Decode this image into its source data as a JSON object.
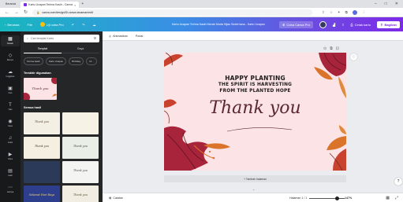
{
  "browser": {
    "tabs": [
      {
        "label": "Beranda"
      },
      {
        "label": "Kartu Ucapan Terima Kasih - Canva"
      }
    ],
    "url": "canva.com/design/Dl-canva-tanaman/edit",
    "controls": [
      "–",
      "□",
      "✕"
    ]
  },
  "header": {
    "home_label": "Beranda",
    "file_label": "File",
    "trial_label": "Uji coba Pro",
    "doc_title": "Kartu Ucapan Terima Kasih Merah Muda Hijau Sederhana - Kartu Ucapan",
    "pro_button": "Coba Canva Pro",
    "print_label": "Cetak kartu",
    "share_label": "Bagikan"
  },
  "rail": {
    "items": [
      {
        "label": "Desain",
        "icon": "▦"
      },
      {
        "label": "Elemen",
        "icon": "◇"
      },
      {
        "label": "Unggahan",
        "icon": "☁"
      },
      {
        "label": "Foto",
        "icon": "▣"
      },
      {
        "label": "Teks",
        "icon": "T"
      },
      {
        "label": "Gaya",
        "icon": "◉"
      },
      {
        "label": "Audio",
        "icon": "♫"
      },
      {
        "label": "Video",
        "icon": "▶"
      },
      {
        "label": "Latar",
        "icon": "▤"
      },
      {
        "label": "Lainnya",
        "icon": "⋯"
      }
    ]
  },
  "panel": {
    "search_placeholder": "Cari templat Kartu",
    "tabs": [
      {
        "label": "Templat"
      },
      {
        "label": "Gaya"
      }
    ],
    "chips": [
      "Terima kasih",
      "Kartu Ucapan",
      "Birthday",
      "Ul..."
    ],
    "recent_heading": "Terakhir digunakan",
    "all_heading": "Semua hasil",
    "recent_thumb_text": "Thank you",
    "templates": [
      {
        "text": "Thank you",
        "color": "#f3efe4",
        "text_color": "#5a4634"
      },
      {
        "text": "",
        "color": "#f7f2e6",
        "text_color": "#555"
      },
      {
        "text": "Thank you",
        "color": "#f5efe2",
        "text_color": "#3d3a2a"
      },
      {
        "text": "Thank you",
        "color": "#e9eee6",
        "text_color": "#3e4a3a"
      },
      {
        "text": "",
        "color": "#2c3a5a",
        "text_color": "#ffffff"
      },
      {
        "text": "Thank you",
        "color": "#f4f4f2",
        "text_color": "#4a4a4a"
      },
      {
        "text": "Selamat Hari Raya",
        "color": "#2d3e8c",
        "text_color": "#f6d970"
      },
      {
        "text": "Thank you",
        "color": "#f1ede3",
        "text_color": "#5a4e32"
      }
    ]
  },
  "toolbar": {
    "animate_label": "Animasikan",
    "position_label": "Posisi"
  },
  "card": {
    "line1": "HAPPY PLANTING",
    "line2": "THE SPIRIT IS HARVESTING",
    "line3": "FROM THE PLANTED HOPE",
    "script": "Thank you"
  },
  "workspace": {
    "add_page": "+ Tambah halaman"
  },
  "bottombar": {
    "notes_label": "Catatan",
    "pages_label": "Halaman 1 / 1",
    "zoom": "147%",
    "zoom_fraction": 0.78
  },
  "colors": {
    "accent": "#7d2ae8",
    "card_bg": "#fbe3e6",
    "flower_red": "#a8243a",
    "leaf_orange": "#d9742a"
  }
}
